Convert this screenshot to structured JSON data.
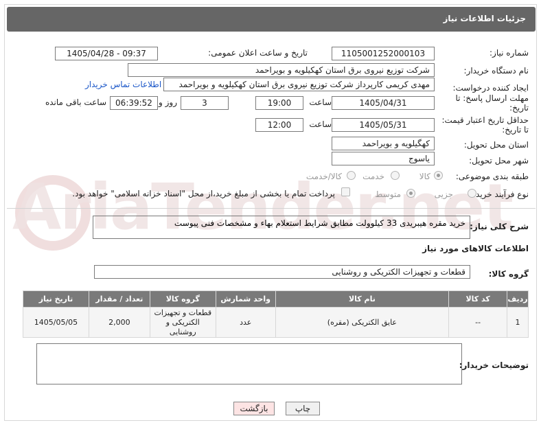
{
  "header": {
    "title": "جزئیات اطلاعات نیاز"
  },
  "fields": {
    "need_number_label": "شماره نیاز:",
    "need_number": "1105001252000103",
    "announce_label": "تاریخ و ساعت اعلان عمومی:",
    "announce_value": "1405/04/28 - 09:37",
    "buyer_org_label": "نام دستگاه خریدار:",
    "buyer_org": "شرکت توزیع نیروی برق استان کهکیلویه و بویراحمد",
    "creator_label": "ایجاد کننده درخواست:",
    "creator": "مهدی کریمی کارپرداز شرکت توزیع نیروی برق استان کهکیلویه و بویراحمد",
    "contact_link": "اطلاعات تماس خریدار",
    "reply_deadline_label_1": "مهلت ارسال پاسخ: تا",
    "reply_deadline_label_2": "تاریخ:",
    "reply_date": "1405/04/31",
    "time_label": "ساعت",
    "reply_time": "19:00",
    "days_value": "3",
    "days_label": "روز و",
    "remaining_time": "06:39:52",
    "remaining_label": "ساعت باقی مانده",
    "price_deadline_label_1": "حداقل تاریخ اعتبار قیمت:",
    "price_deadline_label_2": "تا تاریخ:",
    "price_date": "1405/05/31",
    "price_time": "12:00",
    "province_label": "استان محل تحویل:",
    "province": "کهگیلویه و بویراحمد",
    "city_label": "شهر محل تحویل:",
    "city": "یاسوج",
    "category_label": "طبقه بندی موضوعی:",
    "category_options": [
      "کالا",
      "خدمت",
      "کالا/خدمت"
    ],
    "process_label": "نوع فرآیند خرید :",
    "process_options": [
      "جزیی",
      "متوسط"
    ],
    "payment_note": "پرداخت تمام یا بخشی از مبلغ خرید،از محل \"اسناد خزانه اسلامی\" خواهد بود."
  },
  "description": {
    "label": "شرح کلی نیاز:",
    "value": "خرید مقره هیبریدی 33 کیلوولت مطابق شرایط استعلام بهاء و مشخصات فنی پیوست"
  },
  "goods_info_title": "اطلاعات کالاهای مورد نیاز",
  "goods_group": {
    "label": "گروه کالا:",
    "value": "قطعات و تجهیزات الکتریکی و روشنایی"
  },
  "table": {
    "headers": [
      "ردیف",
      "کد کالا",
      "نام کالا",
      "واحد شمارش",
      "گروه کالا",
      "تعداد / مقدار",
      "تاریخ نیاز"
    ],
    "rows": [
      {
        "row": "1",
        "code": "--",
        "name": "عایق الکتریکی (مقره)",
        "unit": "عدد",
        "group_lines": [
          "قطعات و تجهیزات",
          "الکتریکی و",
          "روشنایی"
        ],
        "qty": "2,000",
        "date": "1405/05/05"
      }
    ]
  },
  "buyer_notes": {
    "label": "توضیحات خریدار:",
    "value": ""
  },
  "buttons": {
    "print": "چاپ",
    "back": "بازگشت"
  },
  "watermark": "AriaTender.net"
}
